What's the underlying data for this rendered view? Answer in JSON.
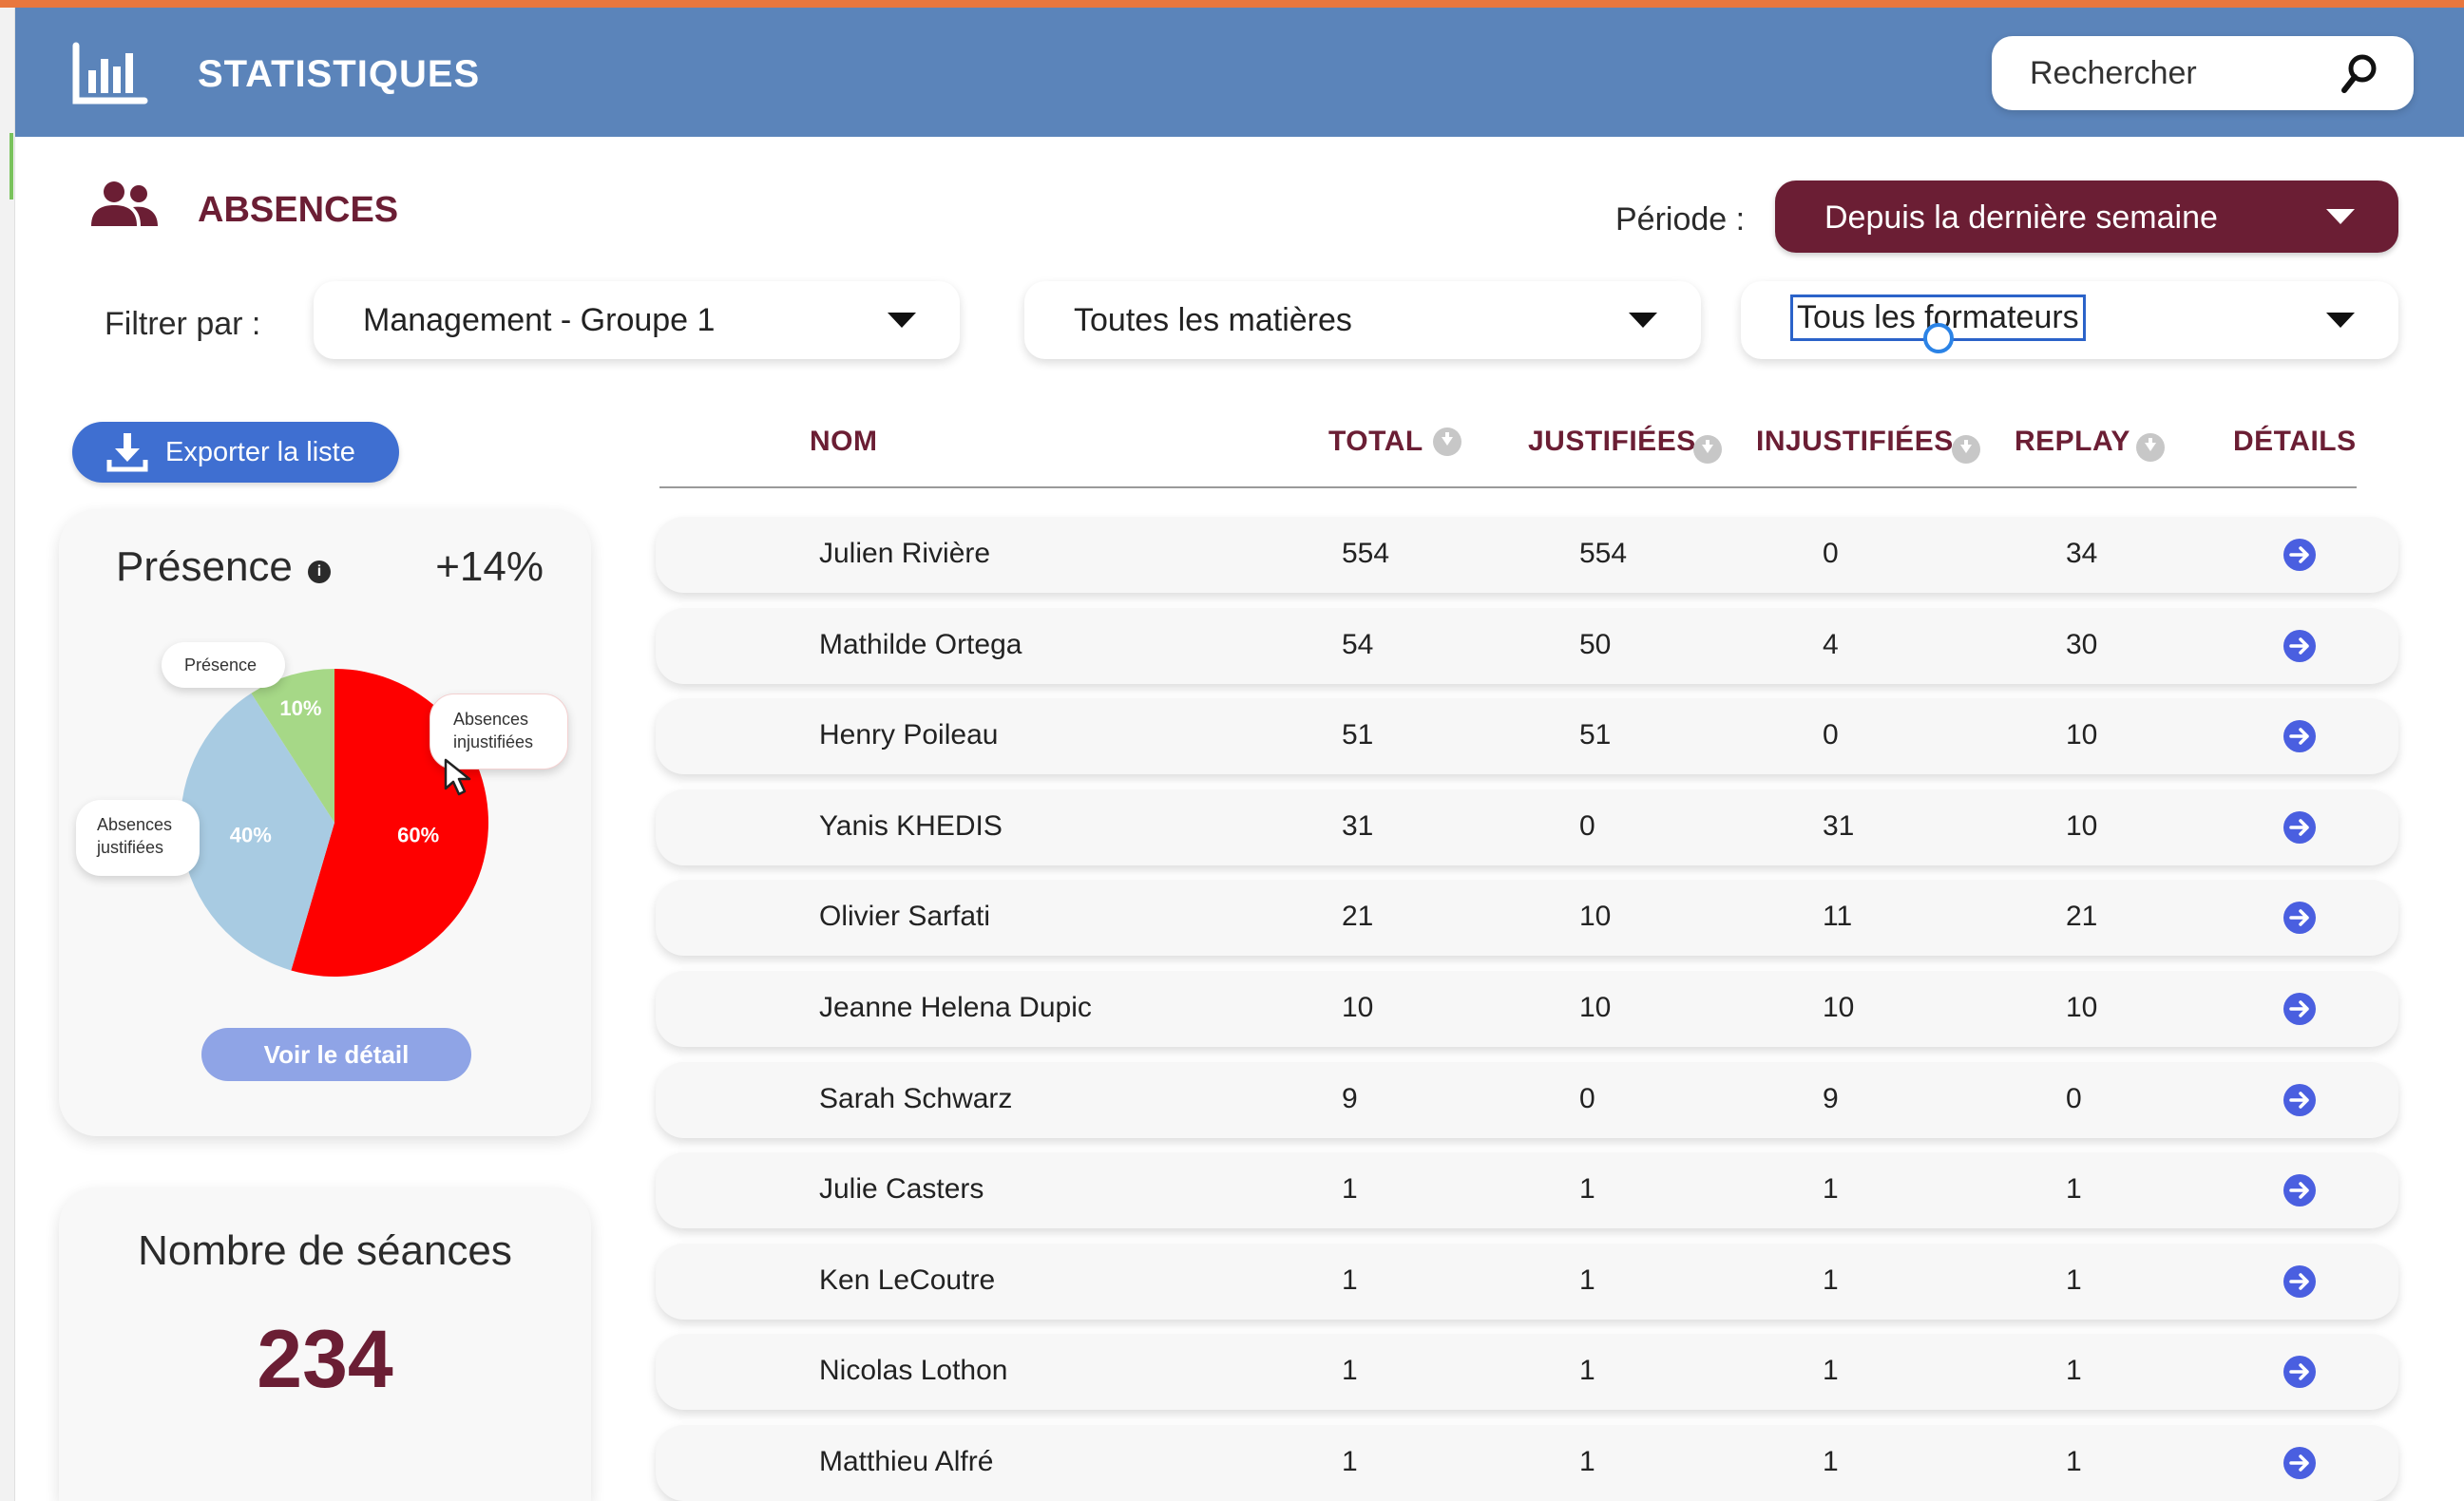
{
  "header": {
    "title": "STATISTIQUES",
    "search_placeholder": "Rechercher"
  },
  "section": {
    "title": "ABSENCES"
  },
  "periode": {
    "label": "Période :",
    "value": "Depuis la dernière semaine"
  },
  "filters": {
    "label": "Filtrer par :",
    "group": "Management - Groupe 1",
    "subject": "Toutes les matières",
    "trainer": "Tous les formateurs"
  },
  "export_label": "Exporter la liste",
  "presence_card": {
    "title": "Présence",
    "delta": "+14%",
    "bubbles": {
      "presence": "Présence",
      "unjustified_1": "Absences",
      "unjustified_2": "injustifiées",
      "justified_1": "Absences",
      "justified_2": "justifiées"
    },
    "detail_button": "Voir le détail"
  },
  "chart_data": {
    "type": "pie",
    "slices": [
      {
        "label": "Absences injustifiées",
        "value": 60,
        "display": "60%",
        "color": "#fe0000"
      },
      {
        "label": "Absences justifiées",
        "value": 40,
        "display": "40%",
        "color": "#a8cbe2"
      },
      {
        "label": "Présence",
        "value": 10,
        "display": "10%",
        "color": "#a6d887"
      }
    ]
  },
  "seances_card": {
    "title": "Nombre de séances",
    "value": "234"
  },
  "table": {
    "headers": {
      "nom": "NOM",
      "total": "TOTAL",
      "justifiees": "JUSTIFIÉES",
      "injustifiees": "INJUSTIFIÉES",
      "replay": "REPLAY",
      "details": "DÉTAILS"
    },
    "rows": [
      {
        "nom": "Julien Rivière",
        "total": "554",
        "justifiees": "554",
        "injustifiees": "0",
        "replay": "34"
      },
      {
        "nom": "Mathilde Ortega",
        "total": "54",
        "justifiees": "50",
        "injustifiees": "4",
        "replay": "30"
      },
      {
        "nom": "Henry Poileau",
        "total": "51",
        "justifiees": "51",
        "injustifiees": "0",
        "replay": "10"
      },
      {
        "nom": "Yanis KHEDIS",
        "total": "31",
        "justifiees": "0",
        "injustifiees": "31",
        "replay": "10"
      },
      {
        "nom": "Olivier Sarfati",
        "total": "21",
        "justifiees": "10",
        "injustifiees": "11",
        "replay": "21"
      },
      {
        "nom": "Jeanne Helena Dupic",
        "total": "10",
        "justifiees": "10",
        "injustifiees": "10",
        "replay": "10"
      },
      {
        "nom": "Sarah Schwarz",
        "total": "9",
        "justifiees": "0",
        "injustifiees": "9",
        "replay": "0"
      },
      {
        "nom": "Julie Casters",
        "total": "1",
        "justifiees": "1",
        "injustifiees": "1",
        "replay": "1"
      },
      {
        "nom": "Ken LeCoutre",
        "total": "1",
        "justifiees": "1",
        "injustifiees": "1",
        "replay": "1"
      },
      {
        "nom": "Nicolas Lothon",
        "total": "1",
        "justifiees": "1",
        "injustifiees": "1",
        "replay": "1"
      },
      {
        "nom": "Matthieu Alfré",
        "total": "1",
        "justifiees": "1",
        "injustifiees": "1",
        "replay": "1"
      }
    ]
  }
}
